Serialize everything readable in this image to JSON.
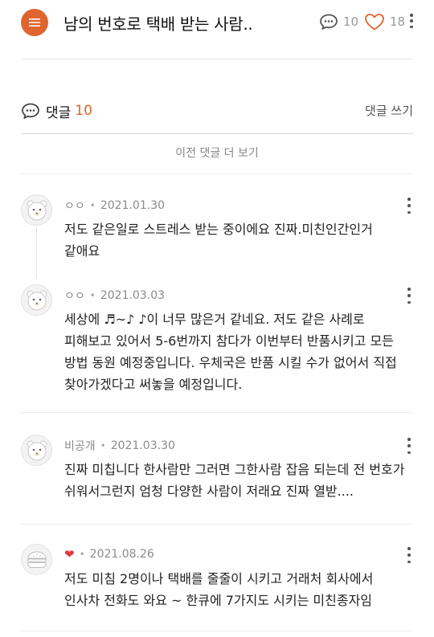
{
  "header": {
    "title": "남의 번호로 택배 받는 사람..",
    "comment_count": "10",
    "like_count": "18"
  },
  "comments_section": {
    "label": "댓글",
    "count": "10",
    "write_label": "댓글 쓰기",
    "load_previous": "이전 댓글 더 보기"
  },
  "comments": [
    {
      "author": "ㅇㅇ",
      "date": "2021.01.30",
      "text": "저도 같은일로 스트레스 받는 중이에요 진짜.미친인간인거 같애요"
    },
    {
      "author": "ㅇㅇ",
      "date": "2021.03.03",
      "text": "세상에 ♬~♪ ♪이 너무 많은거 같네요. 저도 같은 사례로 피해보고 있어서 5-6번까지 참다가 이번부터 반품시키고 모든 방법 동원 예정중입니다. 우체국은 반품 시킬 수가 없어서 직접 찾아가겠다고 써놓을 예정입니다."
    },
    {
      "author": "비공개",
      "date": "2021.03.30",
      "text": "진짜 미칩니다 한사람만 그러면 그한사람 잡음 되는데 전 번호가 쉬워서그런지 엄청 다양한 사람이 저래요 진짜 열받...."
    },
    {
      "author": "❤",
      "date": "2021.08.26",
      "text": "저도 미침 2명이나 택배를 줄줄이 시키고 거래처 회사에서 인사차 전화도 와요 ~ 한큐에 7가지도 시키는 미친종자임"
    }
  ],
  "colors": {
    "accent": "#e0642e",
    "heart": "#e0383e"
  }
}
